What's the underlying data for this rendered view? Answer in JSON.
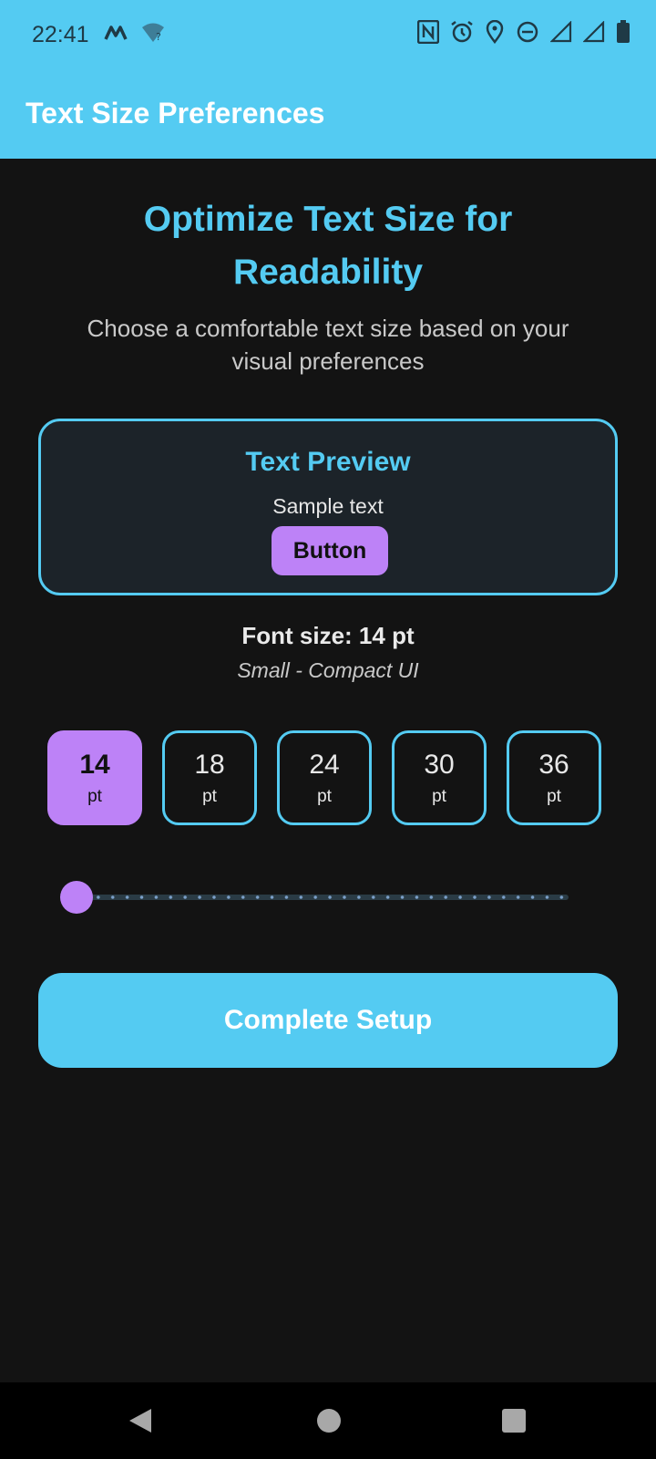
{
  "status_bar": {
    "time": "22:41",
    "icons": [
      "m-logo-icon",
      "wifi-question-icon",
      "nfc-icon",
      "alarm-icon",
      "location-icon",
      "dnd-icon",
      "signal-icon",
      "signal-icon",
      "battery-icon"
    ]
  },
  "app_bar": {
    "title": "Text Size Preferences"
  },
  "main": {
    "headline": "Optimize Text Size for Readability",
    "subtitle": "Choose a comfortable text size based on your visual preferences",
    "preview": {
      "title": "Text Preview",
      "sample_text": "Sample text",
      "button_label": "Button"
    },
    "font_size_label": "Font size: 14 pt",
    "font_size_description": "Small - Compact UI",
    "size_options": [
      {
        "value": "14",
        "unit": "pt",
        "selected": true
      },
      {
        "value": "18",
        "unit": "pt",
        "selected": false
      },
      {
        "value": "24",
        "unit": "pt",
        "selected": false
      },
      {
        "value": "30",
        "unit": "pt",
        "selected": false
      },
      {
        "value": "36",
        "unit": "pt",
        "selected": false
      }
    ],
    "slider": {
      "min": 14,
      "max": 36,
      "value": 14
    },
    "complete_button_label": "Complete Setup"
  },
  "colors": {
    "accent": "#54CBF2",
    "selected": "#BD82F7",
    "background": "#131313",
    "card_background": "#1C2329"
  }
}
